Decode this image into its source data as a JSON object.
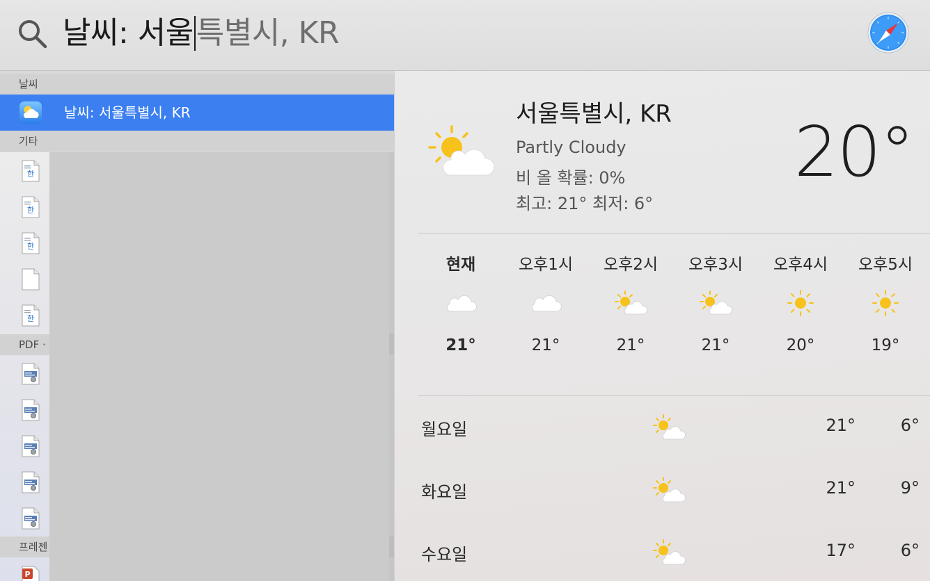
{
  "search": {
    "typed_text": "날씨: 서울",
    "suggestion_text": "특별시, KR"
  },
  "sidebar": {
    "section_weather": "날씨",
    "selected_result": "날씨: 서울특별시, KR",
    "section_other": "기타",
    "section_pdf": "PDF ·",
    "section_presentation": "프레젠",
    "other_items": [
      {
        "icon": "hwp-document-icon"
      },
      {
        "icon": "hwp-document-icon"
      },
      {
        "icon": "hwp-document-icon"
      },
      {
        "icon": "blank-document-icon"
      },
      {
        "icon": "hwp-document-icon"
      }
    ],
    "pdf_items": [
      {
        "icon": "pdf-document-icon"
      },
      {
        "icon": "pdf-document-icon"
      },
      {
        "icon": "pdf-document-icon"
      },
      {
        "icon": "pdf-document-icon"
      },
      {
        "icon": "pdf-document-icon"
      }
    ],
    "presentation_items": [
      {
        "icon": "powerpoint-icon"
      }
    ]
  },
  "weather": {
    "city": "서울특별시, KR",
    "condition": "Partly Cloudy",
    "rain_chance": "비 올 확률: 0%",
    "high_low": "최고: 21° 최저: 6°",
    "current_temp": "20°",
    "current_icon": "partly-cloudy-icon",
    "hourly": [
      {
        "label": "현재",
        "temp": "21°",
        "icon": "cloudy-icon"
      },
      {
        "label": "오후1시",
        "temp": "21°",
        "icon": "cloudy-icon"
      },
      {
        "label": "오후2시",
        "temp": "21°",
        "icon": "partly-cloudy-icon"
      },
      {
        "label": "오후3시",
        "temp": "21°",
        "icon": "partly-cloudy-icon"
      },
      {
        "label": "오후4시",
        "temp": "20°",
        "icon": "sunny-icon"
      },
      {
        "label": "오후5시",
        "temp": "19°",
        "icon": "sunny-icon"
      }
    ],
    "daily": [
      {
        "day": "월요일",
        "high": "21°",
        "low": "6°",
        "icon": "partly-cloudy-icon"
      },
      {
        "day": "화요일",
        "high": "21°",
        "low": "9°",
        "icon": "partly-cloudy-icon"
      },
      {
        "day": "수요일",
        "high": "17°",
        "low": "6°",
        "icon": "partly-cloudy-icon"
      }
    ]
  },
  "colors": {
    "selection_blue": "#3b7ff0",
    "sun_yellow": "#f6c21b"
  }
}
